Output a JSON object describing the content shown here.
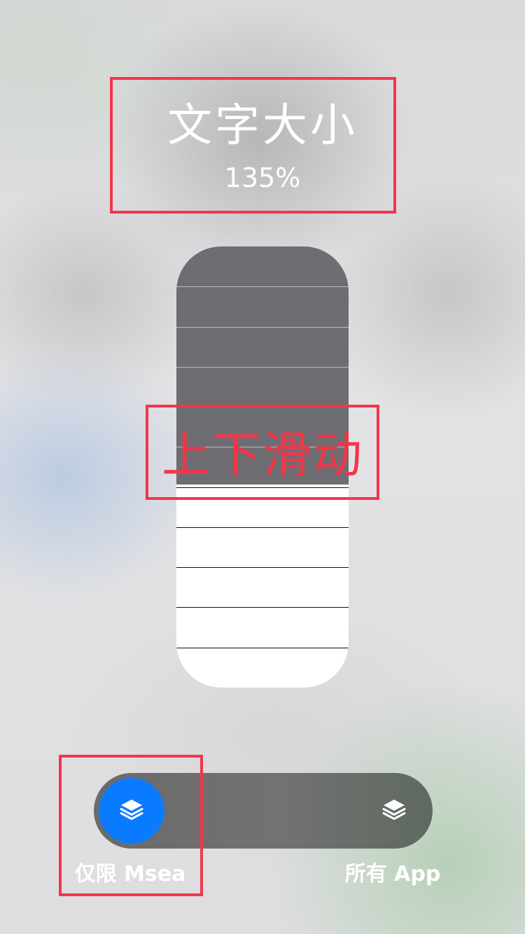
{
  "header": {
    "title": "文字大小",
    "percent": "135%"
  },
  "slider": {
    "level_fraction": 0.46,
    "segments": 11
  },
  "annotation": {
    "label": "上下滑动",
    "color": "#f2364a"
  },
  "scope_toggle": {
    "selected": "left",
    "left_label": "仅限 Msea",
    "right_label": "所有 App",
    "left_icon": "layers-icon",
    "right_icon": "layers-icon",
    "accent_color": "#0a7bff"
  }
}
